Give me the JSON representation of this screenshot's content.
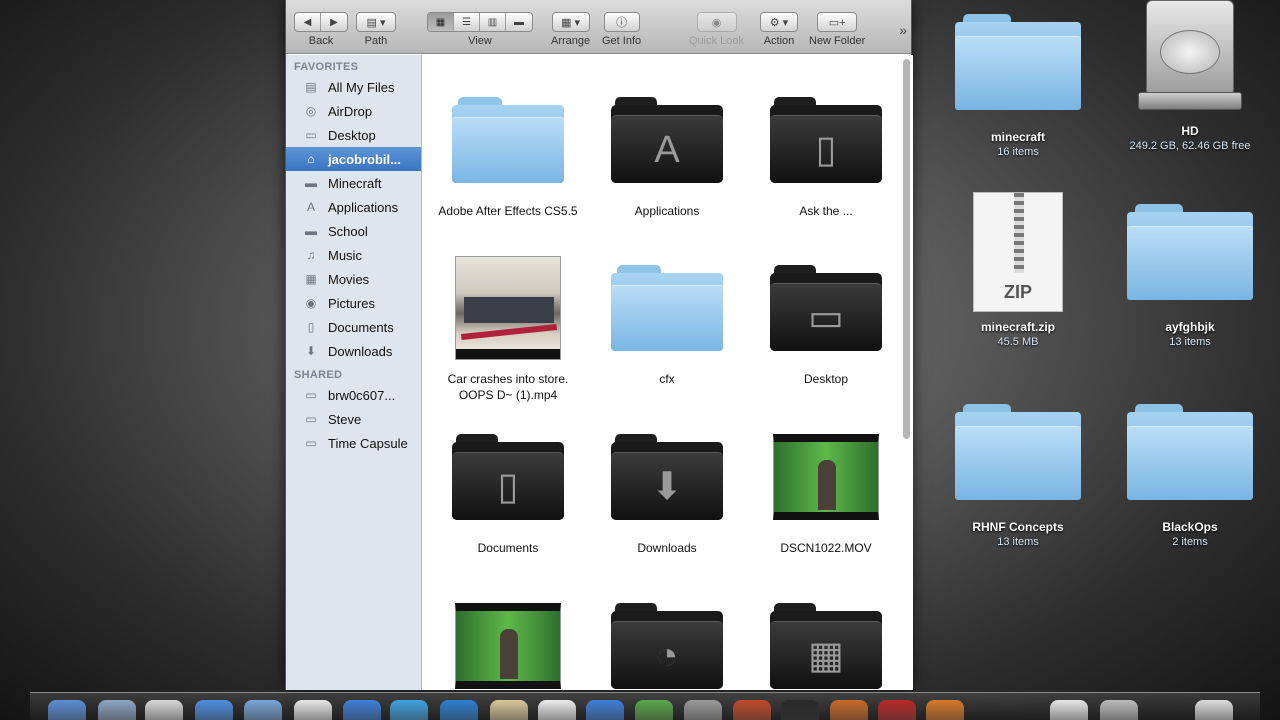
{
  "window": {
    "title": "jacobrobil..."
  },
  "toolbar": {
    "back_label": "Back",
    "path_label": "Path",
    "view_label": "View",
    "arrange_label": "Arrange",
    "get_info_label": "Get Info",
    "quick_look_label": "Quick Look",
    "action_label": "Action",
    "new_folder_label": "New Folder"
  },
  "sidebar": {
    "favorites_heading": "FAVORITES",
    "favorites": [
      {
        "label": "All My Files",
        "icon": "all-files-icon"
      },
      {
        "label": "AirDrop",
        "icon": "airdrop-icon"
      },
      {
        "label": "Desktop",
        "icon": "desktop-icon"
      },
      {
        "label": "jacobrobil...",
        "icon": "home-icon",
        "selected": true
      },
      {
        "label": "Minecraft",
        "icon": "folder-icon"
      },
      {
        "label": "Applications",
        "icon": "applications-icon"
      },
      {
        "label": "School",
        "icon": "folder-icon"
      },
      {
        "label": "Music",
        "icon": "music-icon"
      },
      {
        "label": "Movies",
        "icon": "movies-icon"
      },
      {
        "label": "Pictures",
        "icon": "pictures-icon"
      },
      {
        "label": "Documents",
        "icon": "documents-icon"
      },
      {
        "label": "Downloads",
        "icon": "downloads-icon"
      }
    ],
    "shared_heading": "SHARED",
    "shared": [
      {
        "label": "brw0c607...",
        "icon": "computer-icon"
      },
      {
        "label": "Steve",
        "icon": "computer-icon"
      },
      {
        "label": "Time Capsule",
        "icon": "time-capsule-icon"
      }
    ]
  },
  "content": {
    "items": [
      {
        "label": "Adobe After Effects CS5.5",
        "kind": "folder-blue"
      },
      {
        "label": "Applications",
        "kind": "folder-dark",
        "glyph": "A"
      },
      {
        "label": "Ask the ...",
        "kind": "folder-dark",
        "glyph": "▯"
      },
      {
        "label": "Car crashes into store. OOPS D~ (1).mp4",
        "kind": "video"
      },
      {
        "label": "cfx",
        "kind": "folder-blue"
      },
      {
        "label": "Desktop",
        "kind": "folder-dark",
        "glyph": "▭"
      },
      {
        "label": "Documents",
        "kind": "folder-dark",
        "glyph": "▯"
      },
      {
        "label": "Downloads",
        "kind": "folder-dark",
        "glyph": "⬇"
      },
      {
        "label": "DSCN1022.MOV",
        "kind": "video-green"
      },
      {
        "label": "",
        "kind": "video-green"
      },
      {
        "label": "",
        "kind": "folder-dark",
        "glyph": "◔"
      },
      {
        "label": "",
        "kind": "folder-dark",
        "glyph": "▦"
      }
    ]
  },
  "desktop": {
    "items": [
      {
        "name": "minecraft",
        "sub": "16 items",
        "kind": "folder"
      },
      {
        "name": "HD",
        "sub": "249.2 GB, 62.46 GB free",
        "kind": "disk"
      },
      {
        "name": "minecraft.zip",
        "sub": "45.5 MB",
        "kind": "zip",
        "badge": "ZIP"
      },
      {
        "name": "ayfghbjk",
        "sub": "13 items",
        "kind": "folder"
      },
      {
        "name": "RHNF Concepts",
        "sub": "13 items",
        "kind": "folder"
      },
      {
        "name": "BlackOps",
        "sub": "2 items",
        "kind": "folder"
      }
    ]
  },
  "colors": {
    "sidebar_bg": "#dfe5ec",
    "selection": "#3a74c3",
    "folder_blue": "#7ab6e3"
  }
}
